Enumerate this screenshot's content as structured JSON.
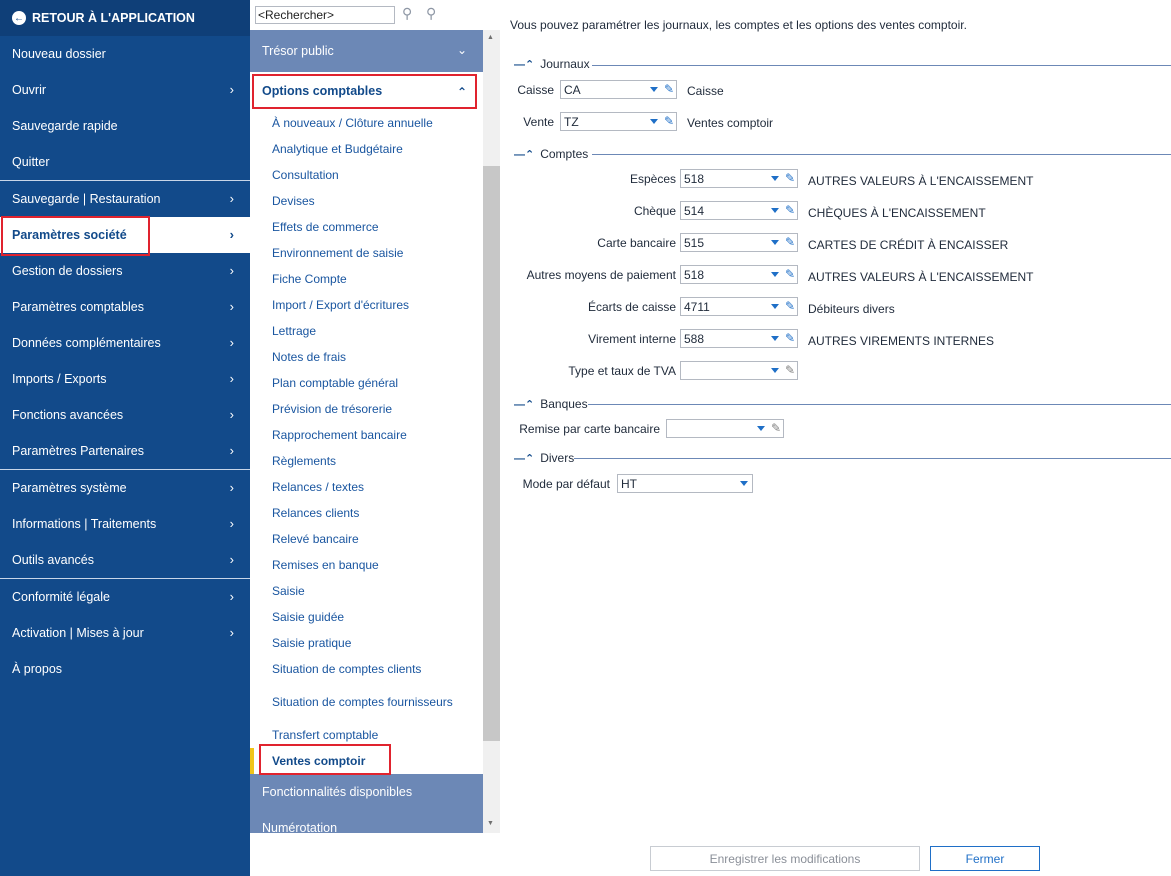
{
  "leftnav": {
    "back_label": "RETOUR À L'APPLICATION",
    "items": [
      {
        "label": "Nouveau dossier"
      },
      {
        "label": "Ouvrir"
      },
      {
        "label": "Sauvegarde rapide"
      },
      {
        "label": "Quitter"
      },
      {
        "label": "Sauvegarde | Restauration"
      },
      {
        "label": "Paramètres société"
      },
      {
        "label": "Gestion de dossiers"
      },
      {
        "label": "Paramètres comptables"
      },
      {
        "label": "Données complémentaires"
      },
      {
        "label": "Imports / Exports"
      },
      {
        "label": "Fonctions avancées"
      },
      {
        "label": "Paramètres Partenaires"
      },
      {
        "label": "Paramètres système"
      },
      {
        "label": "Informations | Traitements"
      },
      {
        "label": "Outils avancés"
      },
      {
        "label": "Conformité légale"
      },
      {
        "label": "Activation | Mises à jour"
      },
      {
        "label": "À propos"
      }
    ]
  },
  "search": {
    "placeholder": "<Rechercher>"
  },
  "tree": {
    "group_top": "Trésor public",
    "group_open": "Options comptables",
    "items": [
      "À nouveaux / Clôture annuelle",
      "Analytique et Budgétaire",
      "Consultation",
      "Devises",
      "Effets de commerce",
      "Environnement de saisie",
      "Fiche Compte",
      "Import / Export d'écritures",
      "Lettrage",
      "Notes de frais",
      "Plan comptable général",
      "Prévision de trésorerie",
      "Rapprochement bancaire",
      "Règlements",
      "Relances / textes",
      "Relances clients",
      "Relevé bancaire",
      "Remises en banque",
      "Saisie",
      "Saisie guidée",
      "Saisie pratique",
      "Situation de comptes clients",
      "Situation de comptes fournisseurs",
      "Transfert comptable",
      "Ventes comptoir"
    ],
    "group_after_1": "Fonctionnalités disponibles",
    "group_after_2": "Numérotation"
  },
  "content": {
    "intro": "Vous pouvez paramétrer les journaux, les comptes et les options des ventes comptoir.",
    "journaux": {
      "title": "Journaux",
      "rows": [
        {
          "label": "Caisse",
          "value": "CA",
          "desc": "Caisse"
        },
        {
          "label": "Vente",
          "value": "TZ",
          "desc": "Ventes comptoir"
        }
      ]
    },
    "comptes": {
      "title": "Comptes",
      "rows": [
        {
          "label": "Espèces",
          "value": "518",
          "desc": "AUTRES VALEURS À L'ENCAISSEMENT"
        },
        {
          "label": "Chèque",
          "value": "514",
          "desc": "CHÈQUES À L'ENCAISSEMENT"
        },
        {
          "label": "Carte bancaire",
          "value": "515",
          "desc": "CARTES DE CRÉDIT À ENCAISSER"
        },
        {
          "label": "Autres moyens de paiement",
          "value": "518",
          "desc": "AUTRES VALEURS À L'ENCAISSEMENT"
        },
        {
          "label": "Écarts de caisse",
          "value": "4711",
          "desc": "Débiteurs divers"
        },
        {
          "label": "Virement interne",
          "value": "588",
          "desc": "AUTRES VIREMENTS INTERNES"
        },
        {
          "label": "Type et taux de TVA",
          "value": "",
          "desc": ""
        }
      ]
    },
    "banques": {
      "title": "Banques",
      "label": "Remise par carte bancaire",
      "value": ""
    },
    "divers": {
      "title": "Divers",
      "label": "Mode par défaut",
      "value": "HT"
    }
  },
  "buttons": {
    "save": "Enregistrer les modifications",
    "close": "Fermer"
  },
  "colors": {
    "nav_bg": "#124a8a",
    "tree_header": "#6c88b6",
    "link": "#1a56a0",
    "highlight_outline": "#e0232e",
    "selection_marker": "#f0c419"
  }
}
